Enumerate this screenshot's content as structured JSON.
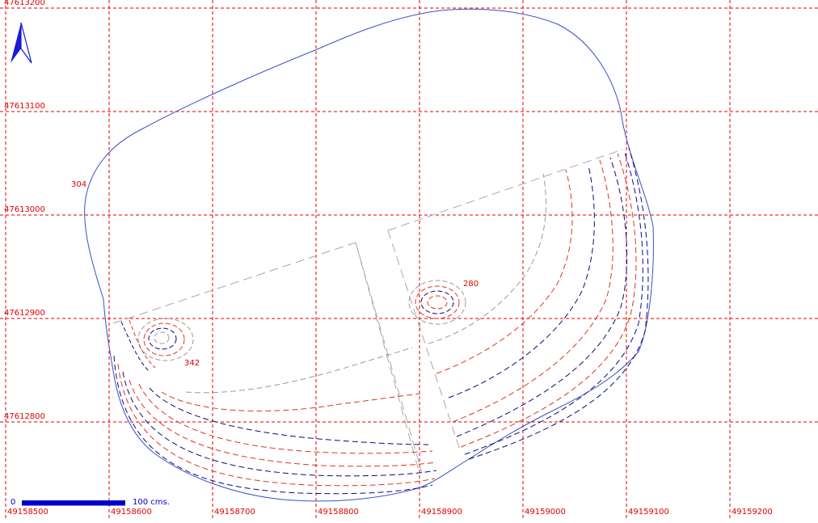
{
  "colors": {
    "grid": "#e00000",
    "grid_label": "#e00000",
    "boundary": "#3a4fc8",
    "contour_red": "#e0341e",
    "contour_navy": "#0a0a7a",
    "contour_grey": "#9a9a9a",
    "spot_label": "#e00000",
    "scale_bar": "#0000cc",
    "north_arrow": "#1a1ad0",
    "background": "#ffffff"
  },
  "north_arrow": {
    "icon": "north-arrow-icon"
  },
  "grid": {
    "easting_labels": [
      "49158500",
      "49158600",
      "49158700",
      "49158800",
      "49158900",
      "49159000",
      "49159100",
      "49159200"
    ],
    "northing_labels": [
      "47613200",
      "47613100",
      "47613000",
      "47612900",
      "47612800"
    ]
  },
  "spot_heights": [
    {
      "id": "spot-304",
      "text": "304"
    },
    {
      "id": "spot-280",
      "text": "280"
    },
    {
      "id": "spot-342",
      "text": "342"
    }
  ],
  "scale_bar": {
    "start_label": "0",
    "end_label": "100 cms."
  }
}
